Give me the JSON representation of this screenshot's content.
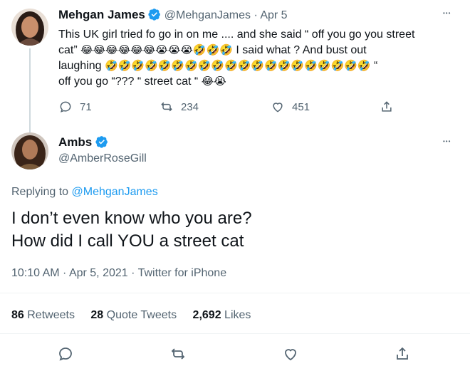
{
  "tweet1": {
    "name": "Mehgan James",
    "handle": "@MehganJames",
    "date": "· Apr 5",
    "text_line1": "This UK girl tried fo go in on me .... and she said “ off you go you street",
    "text_line2_pre": "cat”",
    "text_line2_emojis": "😂😂😂😂😂😂😭😭😭🤣🤣🤣",
    "text_line2_post": "I said what ? And bust out",
    "text_line3_pre": "laughing",
    "text_line3_emojis": "🤣🤣🤣🤣🤣🤣🤣🤣🤣🤣🤣🤣🤣🤣🤣🤣🤣🤣🤣🤣",
    "text_line3_post": "“",
    "text_line4_pre": "off you go “??? “ street cat “",
    "text_line4_emojis": "😂😭",
    "replies": "71",
    "retweets": "234",
    "likes": "451",
    "more": "•••"
  },
  "tweet2": {
    "name": "Ambs",
    "handle": "@AmberRoseGill",
    "more": "•••",
    "replying_prefix": "Replying to",
    "replying_handle": "@MehganJames",
    "text_line1": "I don’t even know who you are?",
    "text_line2": "How did I call YOU a street cat",
    "timestamp": "10:10 AM · Apr 5, 2021 · Twitter for iPhone",
    "retweets_count": "86",
    "retweets_label": "Retweets",
    "quotes_count": "28",
    "quotes_label": "Quote Tweets",
    "likes_count": "2,692",
    "likes_label": "Likes"
  },
  "colors": {
    "accent": "#1d9bf0",
    "muted": "#536471",
    "divider": "#eff3f4"
  }
}
